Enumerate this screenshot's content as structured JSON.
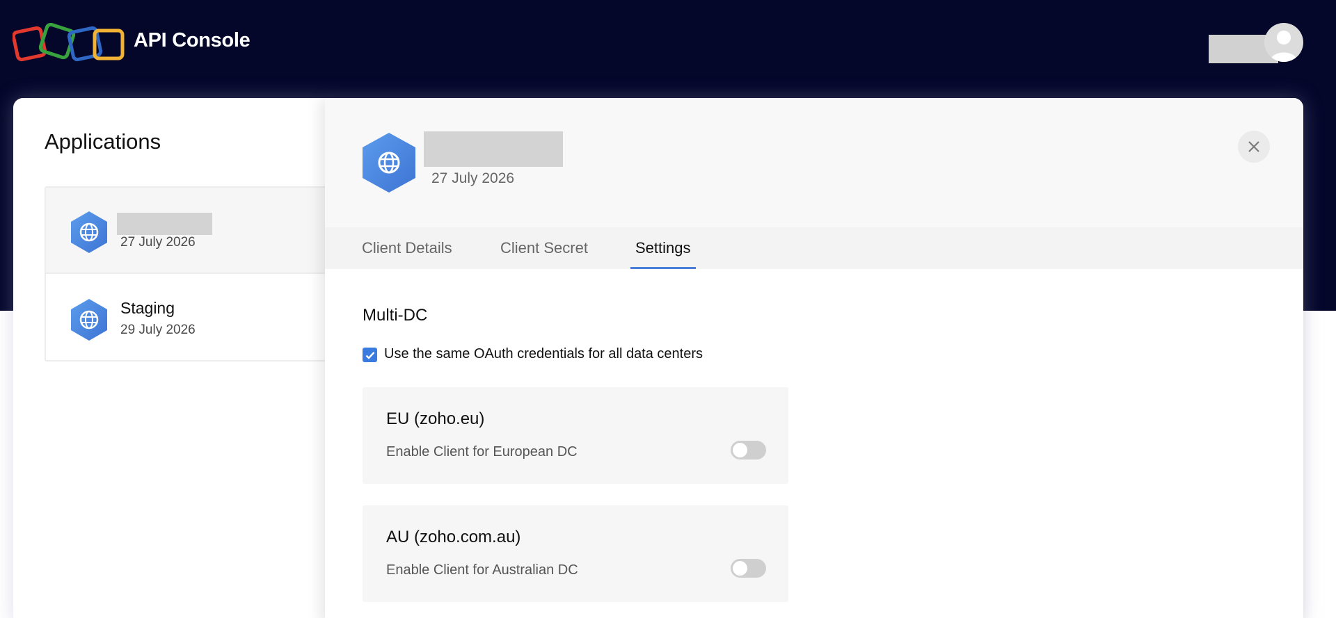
{
  "header": {
    "brand": "API Console",
    "logo_colors": [
      "#e2392f",
      "#38a33e",
      "#2f68c4",
      "#f2b233"
    ]
  },
  "sidebar": {
    "title": "Applications",
    "items": [
      {
        "name": "",
        "date": "27 July 2026",
        "icon": "globe-icon",
        "selected": true
      },
      {
        "name": "Staging",
        "date": "29 July 2026",
        "icon": "globe-icon",
        "selected": false
      }
    ]
  },
  "panel": {
    "app_date": "27 July 2026",
    "close_icon": "close-icon",
    "tabs": [
      {
        "label": "Client Details",
        "active": false
      },
      {
        "label": "Client Secret",
        "active": false
      },
      {
        "label": "Settings",
        "active": true
      }
    ],
    "multidc": {
      "title": "Multi-DC",
      "checkbox_label": "Use the same OAuth credentials for all data centers",
      "checked": true
    },
    "dcs": [
      {
        "title": "EU (zoho.eu)",
        "desc": "Enable Client for European DC",
        "enabled": false
      },
      {
        "title": "AU (zoho.com.au)",
        "desc": "Enable Client for Australian DC",
        "enabled": false
      }
    ]
  },
  "colors": {
    "header_bg": "#04062a",
    "accent": "#3a7be0",
    "app_icon": "#4a88e0"
  }
}
